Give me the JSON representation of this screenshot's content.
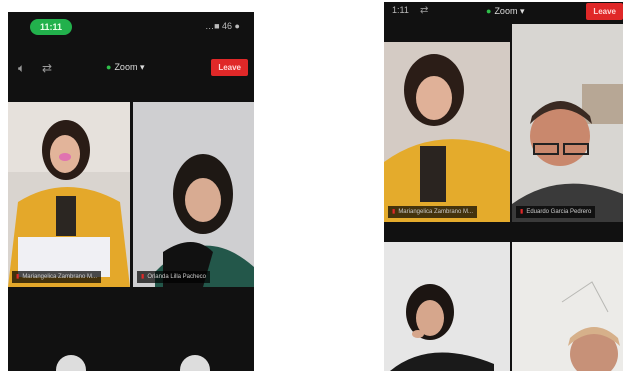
{
  "left_phone": {
    "time": "11:11",
    "status_icons": "…■ 46 ●",
    "zoom_label": "Zoom",
    "leave_label": "Leave",
    "tiles": [
      {
        "name": "Mariangelica Zambrano M..."
      },
      {
        "name": "Orlanda Lilla Pacheco"
      }
    ]
  },
  "right_phone": {
    "time": "1:11",
    "zoom_label": "Zoom",
    "leave_label": "Leave",
    "tiles": [
      {
        "name": "Mariangelica Zambrano M..."
      },
      {
        "name": "Eduardo Garcia Pedrero"
      },
      {
        "name": ""
      },
      {
        "name": ""
      }
    ]
  },
  "icons": {
    "speaker": "speaker-icon",
    "camera_switch": "camera-switch-icon",
    "shield": "shield-icon",
    "microphone_muted": "mic-muted-icon"
  },
  "colors": {
    "background": "#111111",
    "accent_green": "#22b14c",
    "leave_red": "#e02828"
  }
}
